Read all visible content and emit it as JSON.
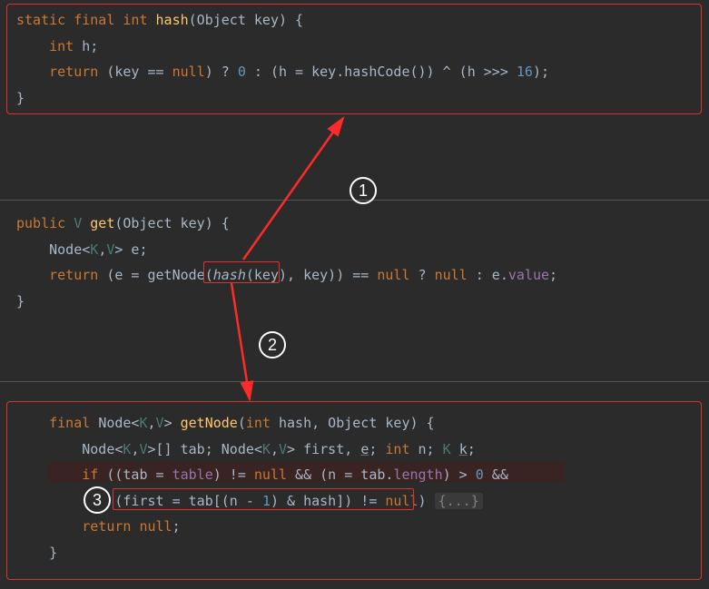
{
  "block1": {
    "l1a": "static final int ",
    "l1b": "hash",
    "l1c": "(Object key) {",
    "l2a": "    int ",
    "l2b": "h;",
    "l3a": "    return ",
    "l3b": "(key == ",
    "l3c": "null",
    "l3d": ") ? ",
    "l3e": "0",
    "l3f": " : (h = key.hashCode()) ^ (h >>> ",
    "l3g": "16",
    "l3h": ");",
    "l4": "}"
  },
  "block2": {
    "l1a": "public ",
    "l1b": "V ",
    "l1c": "get",
    "l1d": "(Object key) {",
    "l2a": "    Node<",
    "l2b": "K",
    "l2c": ",",
    "l2d": "V",
    "l2e": "> e;",
    "l3a": "    return ",
    "l3b": "(e = getNode(",
    "l3c": "hash",
    "l3d": "(key)",
    "l3e": ", key)) == ",
    "l3f": "null",
    "l3g": " ? ",
    "l3h": "null",
    "l3i": " : e.",
    "l3j": "value",
    "l3k": ";",
    "l4": "}"
  },
  "block3": {
    "l1a": "    final ",
    "l1b": "Node<",
    "l1c": "K",
    "l1d": ",",
    "l1e": "V",
    "l1f": "> ",
    "l1g": "getNode",
    "l1h": "(",
    "l1i": "int ",
    "l1j": "hash, Object key) {",
    "l2a": "        Node<",
    "l2b": "K",
    "l2c": ",",
    "l2d": "V",
    "l2e": ">[] tab; Node<",
    "l2f": "K",
    "l2g": ",",
    "l2h": "V",
    "l2i": "> first, ",
    "l2j": "e",
    "l2k": "; ",
    "l2l": "int ",
    "l2m": "n; ",
    "l2n": "K ",
    "l2o": "k",
    "l2p": ";",
    "l3a": "        if ",
    "l3b": "((tab = ",
    "l3c": "table",
    "l3d": ") != ",
    "l3e": "null",
    "l3f": " && (n = tab.",
    "l3g": "length",
    "l3h": ") > ",
    "l3i": "0",
    "l3j": " &&",
    "l4a": "            (first = tab[(n - ",
    "l4b": "1",
    "l4c": ") & hash]) != ",
    "l4d": "null",
    "l4e": ") ",
    "l4f": "{...}",
    "l5a": "        return null",
    "l5b": ";",
    "l6": "    }"
  },
  "labels": {
    "c1": "1",
    "c2": "2",
    "c3": "3"
  }
}
